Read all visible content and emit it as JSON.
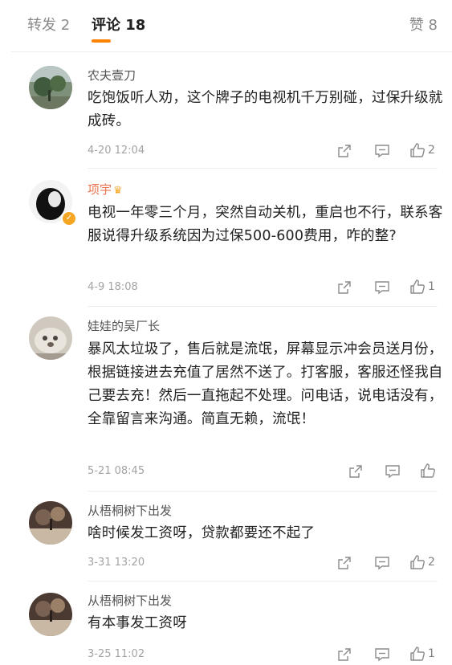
{
  "tabs": {
    "repost": "转发 2",
    "comments": "评论 18",
    "likes": "赞 8"
  },
  "accent_color": "#ff8200",
  "comments": [
    {
      "user": "农夫壹刀",
      "text": "吃饱饭听人劝，这个牌子的电视机千万别碰，过保升级就成砖。",
      "time": "4-20 12:04",
      "likes": "2",
      "avatar": "landscape-avatar"
    },
    {
      "user": "项宇",
      "text": "电视一年零三个月，突然自动关机，重启也不行，联系客服说得升级系统因为过保500-600费用，咋的整?",
      "time": "4-9 18:08",
      "likes": "1",
      "avatar": "silhouette-avatar",
      "verified": true
    },
    {
      "user": "娃娃的吴厂长",
      "text": "暴风太垃圾了，售后就是流氓，屏幕显示冲会员送月份，根据链接进去充值了居然不送了。打客服，客服还怪我自己要去充！然后一直拖起不处理。问电话，说电话没有，全靠留言来沟通。简直无赖，流氓！",
      "time": "5-21 08:45",
      "likes": "",
      "avatar": "dog-avatar"
    },
    {
      "user": "从梧桐树下出发",
      "text": "啥时候发工资呀，贷款都要还不起了",
      "time": "3-31 13:20",
      "likes": "2",
      "avatar": "tree-avatar"
    },
    {
      "user": "从梧桐树下出发",
      "text": "有本事发工资呀",
      "time": "3-25 11:02",
      "likes": "1",
      "avatar": "tree-avatar"
    }
  ]
}
